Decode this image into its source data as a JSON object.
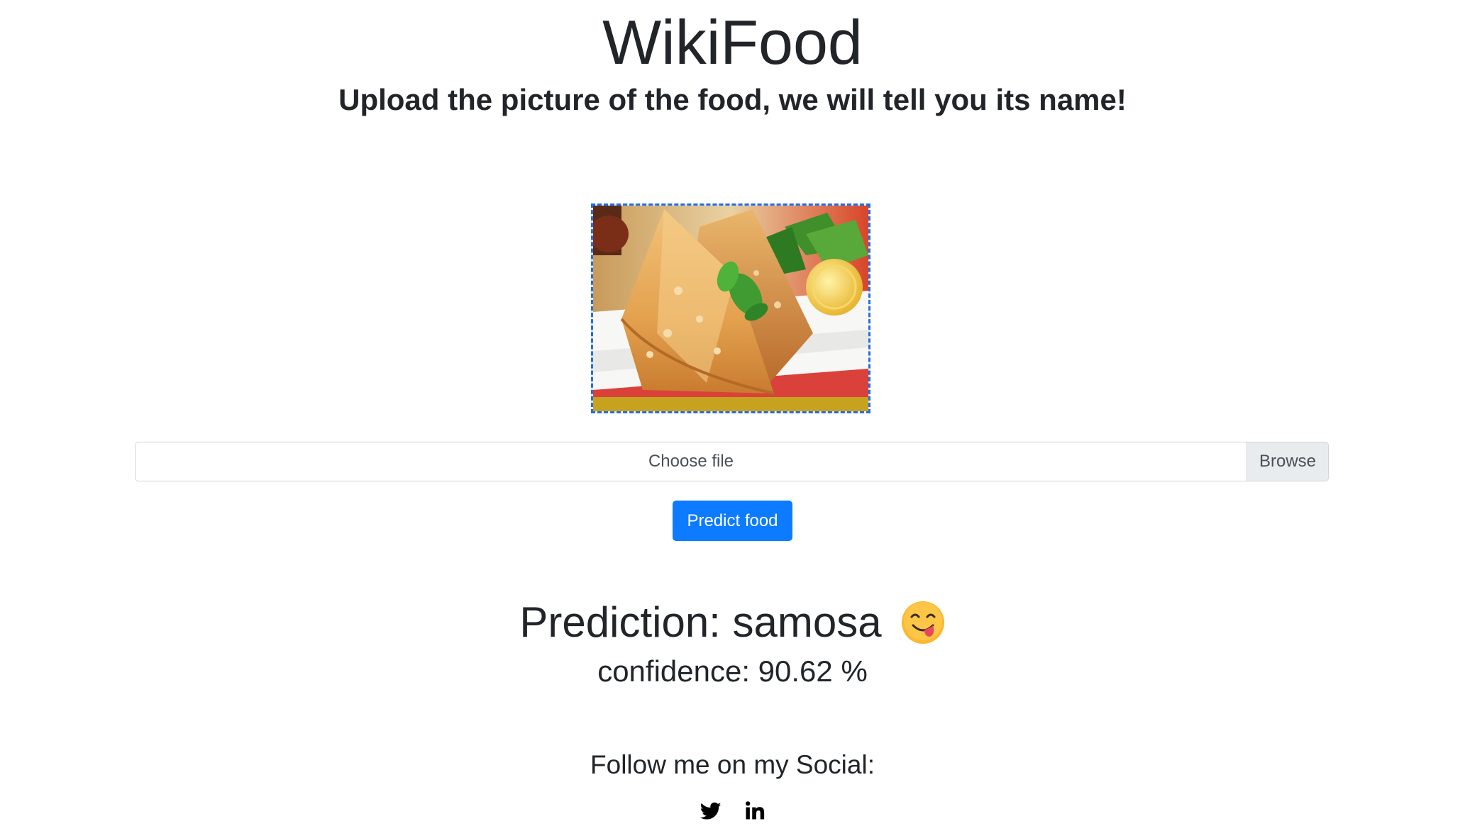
{
  "header": {
    "title": "WikiFood",
    "subtitle": "Upload the picture of the food, we will tell you its name!"
  },
  "upload": {
    "preview_image": "samosa-photo",
    "file_label": "Choose file",
    "browse_label": "Browse",
    "predict_label": "Predict food"
  },
  "result": {
    "prediction_text": "Prediction: samosa",
    "emoji": "face-savoring-food-icon",
    "confidence_text": "confidence: 90.62 %"
  },
  "social": {
    "heading": "Follow me on my Social:",
    "icons": [
      "twitter-icon",
      "linkedin-icon"
    ]
  },
  "colors": {
    "primary_button": "#0d7bff",
    "preview_border": "#1f6fe5",
    "text": "#212529"
  }
}
